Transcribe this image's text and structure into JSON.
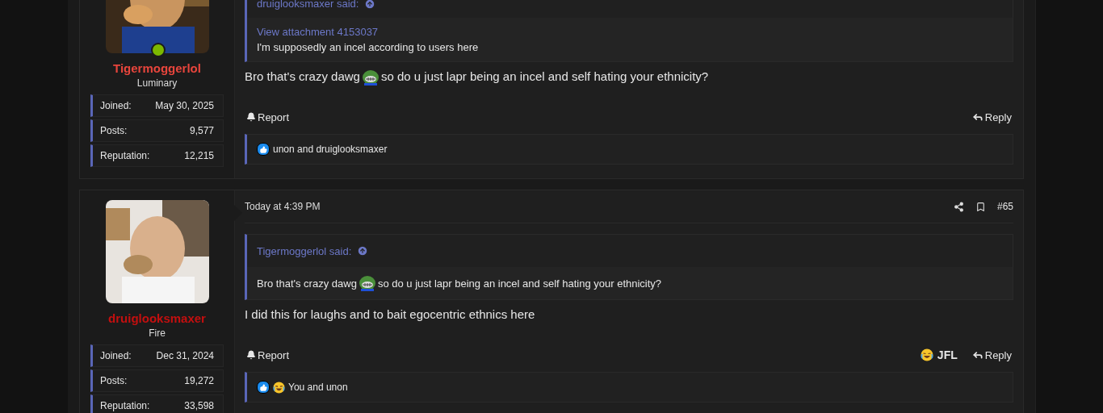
{
  "posts": [
    {
      "author": {
        "name": "Tigermoggerlol",
        "color": "#e8453c",
        "role": "Luminary",
        "online": true,
        "stats": [
          {
            "label": "Joined:",
            "value": "May 30, 2025"
          },
          {
            "label": "Posts:",
            "value": "9,577"
          },
          {
            "label": "Reputation:",
            "value": "12,215"
          }
        ]
      },
      "quote": {
        "author_line": "druiglooksmaxer said:",
        "link": "View attachment 4153037",
        "text": "I'm supposedly an incel according to users here"
      },
      "message": {
        "text_before": "Bro that's crazy dawg",
        "text_after": "so do u just lapr being an incel and self hating your ethnicity?"
      },
      "actions": {
        "report": "Report",
        "reply": "Reply"
      },
      "reactions": {
        "icons": [
          {
            "kind": "like"
          }
        ],
        "text": "unon and druiglooksmaxer"
      }
    },
    {
      "author": {
        "name": "druiglooksmaxer",
        "color": "#c40f0f",
        "role": "Fire",
        "online": false,
        "stats": [
          {
            "label": "Joined:",
            "value": "Dec 31, 2024"
          },
          {
            "label": "Posts:",
            "value": "19,272"
          },
          {
            "label": "Reputation:",
            "value": "33,598"
          }
        ]
      },
      "header": {
        "date": "Today at 4:39 PM",
        "post_number": "#65"
      },
      "quote": {
        "author_line": "Tigermoggerlol said:",
        "text_before": "Bro that's crazy dawg",
        "text_after": "so do u just lapr being an incel and self hating your ethnicity?"
      },
      "message": {
        "text": "I did this for laughs and to bait egocentric ethnics here"
      },
      "actions": {
        "report": "Report",
        "reaction_button": {
          "kind": "haha",
          "label": "JFL"
        },
        "reply": "Reply"
      },
      "reactions": {
        "icons": [
          {
            "kind": "like"
          },
          {
            "kind": "haha"
          }
        ],
        "text": "You and unon"
      }
    }
  ]
}
